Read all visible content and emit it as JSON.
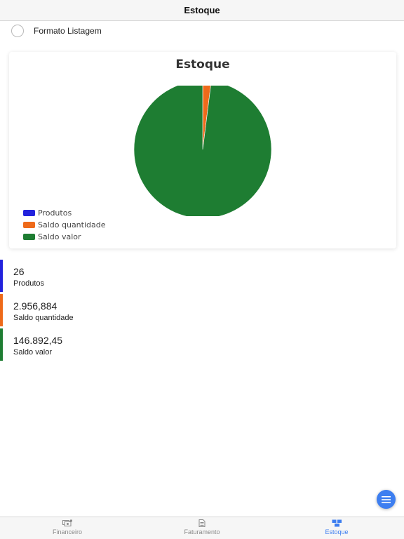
{
  "header": {
    "title": "Estoque"
  },
  "toggle": {
    "label": "Formato Listagem",
    "checked": false
  },
  "chart": {
    "title": "Estoque",
    "legend": [
      {
        "label": "Produtos",
        "color": "#2222dd"
      },
      {
        "label": "Saldo quantidade",
        "color": "#ee6a1a"
      },
      {
        "label": "Saldo valor",
        "color": "#1e7d32"
      }
    ]
  },
  "chart_data": {
    "type": "pie",
    "title": "Estoque",
    "categories": [
      "Produtos",
      "Saldo quantidade",
      "Saldo valor"
    ],
    "values": [
      26,
      2956.884,
      146892.45
    ],
    "colors": [
      "#2222dd",
      "#ee6a1a",
      "#1e7d32"
    ],
    "legend_position": "bottom-left"
  },
  "stats": [
    {
      "value": "26",
      "label": "Produtos",
      "color": "#2222dd"
    },
    {
      "value": "2.956,884",
      "label": "Saldo quantidade",
      "color": "#ee6a1a"
    },
    {
      "value": "146.892,45",
      "label": "Saldo valor",
      "color": "#1e7d32"
    }
  ],
  "fab": {
    "icon": "menu-icon"
  },
  "tabbar": {
    "tabs": [
      {
        "label": "Financeiro",
        "icon": "money-icon",
        "active": false
      },
      {
        "label": "Faturamento",
        "icon": "document-icon",
        "active": false
      },
      {
        "label": "Estoque",
        "icon": "boxes-icon",
        "active": true
      }
    ]
  }
}
